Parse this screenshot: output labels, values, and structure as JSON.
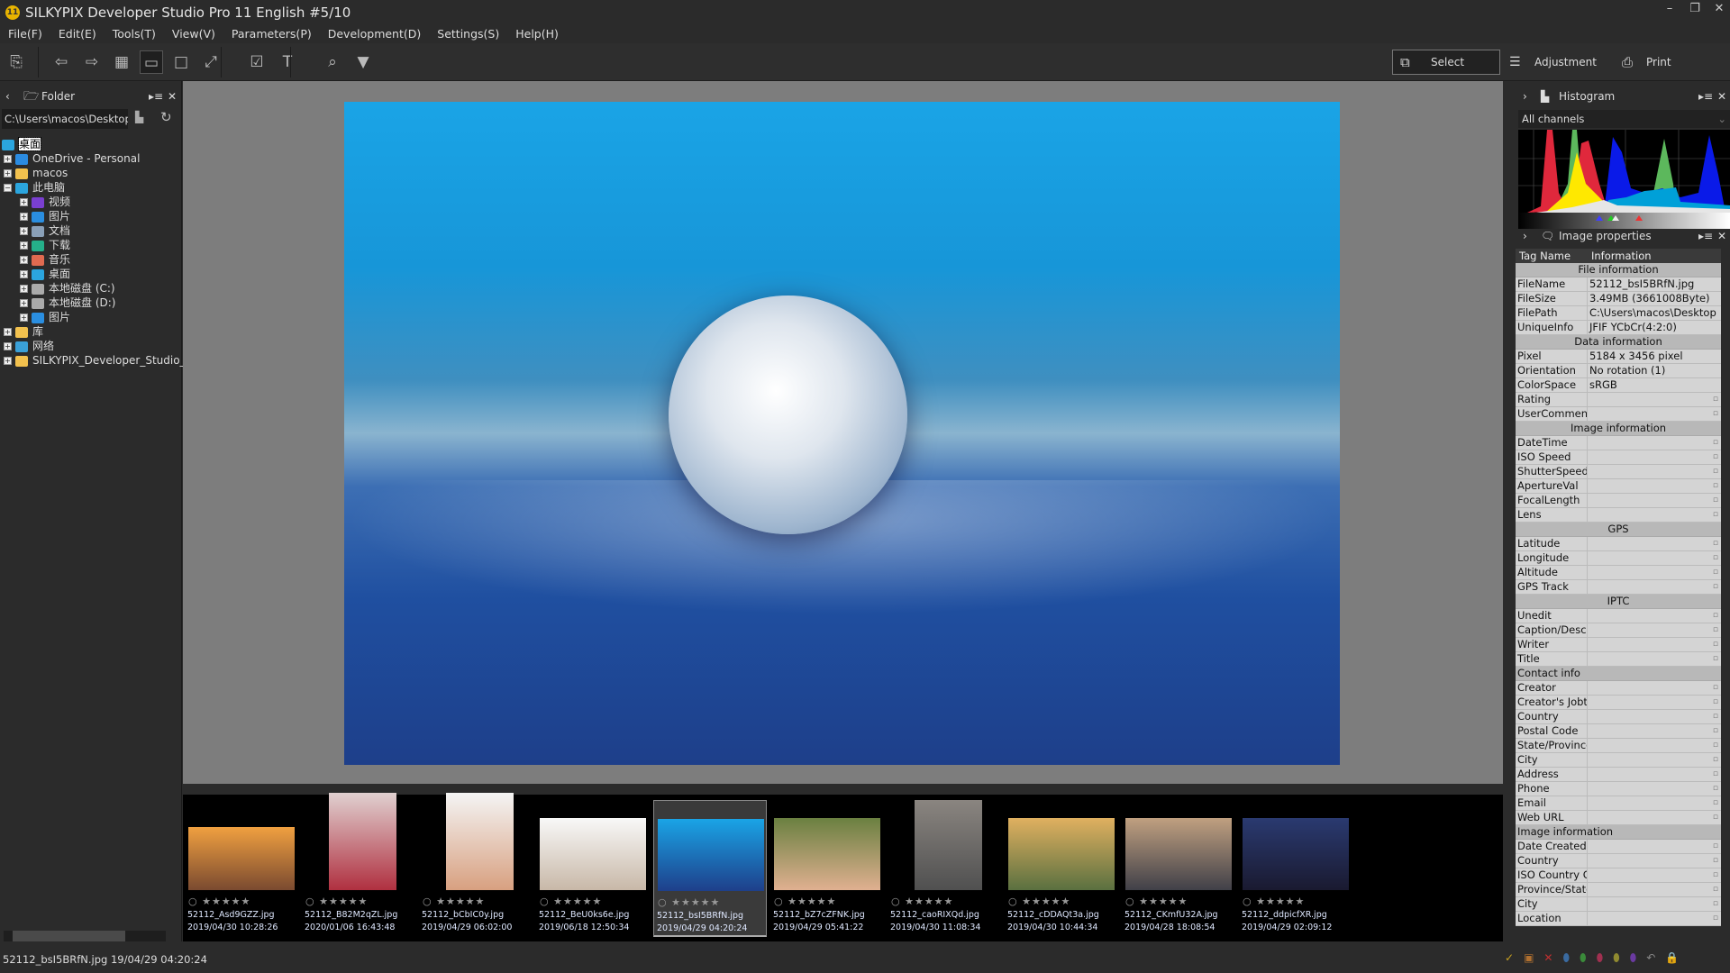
{
  "window": {
    "title": "SILKYPIX Developer Studio Pro 11 English   #5/10",
    "logo": "11"
  },
  "menu": [
    "File(F)",
    "Edit(E)",
    "Tools(T)",
    "View(V)",
    "Parameters(P)",
    "Development(D)",
    "Settings(S)",
    "Help(H)"
  ],
  "modes": {
    "select": "Select",
    "adjustment": "Adjustment",
    "print": "Print"
  },
  "folder_panel": {
    "title": "Folder",
    "path": "C:\\Users\\macos\\Desktop",
    "tree": [
      {
        "label": "桌面",
        "level": 0,
        "exp": "",
        "icon": "#2ba5de",
        "selected": true
      },
      {
        "label": "OneDrive - Personal",
        "level": 1,
        "exp": "+",
        "icon": "#2b8be0"
      },
      {
        "label": "macos",
        "level": 1,
        "exp": "+",
        "icon": "#f2c14e"
      },
      {
        "label": "此电脑",
        "level": 1,
        "exp": "−",
        "icon": "#2ba5de"
      },
      {
        "label": "视频",
        "level": 2,
        "exp": "+",
        "icon": "#7a3fd0"
      },
      {
        "label": "图片",
        "level": 2,
        "exp": "+",
        "icon": "#2a8ee0"
      },
      {
        "label": "文档",
        "level": 2,
        "exp": "+",
        "icon": "#8aa0b8"
      },
      {
        "label": "下载",
        "level": 2,
        "exp": "+",
        "icon": "#25b08a"
      },
      {
        "label": "音乐",
        "level": 2,
        "exp": "+",
        "icon": "#e06a50"
      },
      {
        "label": "桌面",
        "level": 2,
        "exp": "+",
        "icon": "#2ba5de"
      },
      {
        "label": "本地磁盘 (C:)",
        "level": 2,
        "exp": "+",
        "icon": "#aaaaaa"
      },
      {
        "label": "本地磁盘 (D:)",
        "level": 2,
        "exp": "+",
        "icon": "#aaaaaa"
      },
      {
        "label": "图片",
        "level": 2,
        "exp": "+",
        "icon": "#2a8ee0"
      },
      {
        "label": "库",
        "level": 1,
        "exp": "+",
        "icon": "#f2c14e"
      },
      {
        "label": "网络",
        "level": 1,
        "exp": "+",
        "icon": "#3aa0d8"
      },
      {
        "label": "SILKYPIX_Developer_Studio_I",
        "level": 1,
        "exp": "+",
        "icon": "#f2c14e"
      }
    ]
  },
  "histogram": {
    "title": "Histogram",
    "channel": "All channels"
  },
  "properties": {
    "title": "Image properties",
    "col_tag": "Tag Name",
    "col_info": "Information",
    "rows": [
      {
        "s": "File information"
      },
      {
        "k": "FileName",
        "v": "52112_bsI5BRfN.jpg"
      },
      {
        "k": "FileSize",
        "v": "3.49MB (3661008Byte)"
      },
      {
        "k": "FilePath",
        "v": "C:\\Users\\macos\\Desktop"
      },
      {
        "k": "UniqueInfo",
        "v": "JFIF YCbCr(4:2:0)"
      },
      {
        "s": "Data information"
      },
      {
        "k": "Pixel",
        "v": "5184 x 3456 pixel"
      },
      {
        "k": "Orientation",
        "v": "No rotation (1)"
      },
      {
        "k": "ColorSpace",
        "v": "sRGB"
      },
      {
        "k": "Rating",
        "v": ""
      },
      {
        "k": "UserComment",
        "v": ""
      },
      {
        "s": "Image information"
      },
      {
        "k": "DateTime",
        "v": ""
      },
      {
        "k": "ISO Speed",
        "v": ""
      },
      {
        "k": "ShutterSpeed",
        "v": ""
      },
      {
        "k": "ApertureVal",
        "v": ""
      },
      {
        "k": "FocalLength",
        "v": ""
      },
      {
        "k": "Lens",
        "v": ""
      },
      {
        "s": "GPS"
      },
      {
        "k": "Latitude",
        "v": ""
      },
      {
        "k": "Longitude",
        "v": ""
      },
      {
        "k": "Altitude",
        "v": ""
      },
      {
        "k": "GPS Track",
        "v": ""
      },
      {
        "s": "IPTC"
      },
      {
        "k": "Unedit",
        "v": ""
      },
      {
        "k": "Caption/Descri",
        "v": ""
      },
      {
        "k": "Writer",
        "v": ""
      },
      {
        "k": "Title",
        "v": ""
      },
      {
        "sl": "Contact info"
      },
      {
        "k": "Creator",
        "v": ""
      },
      {
        "k": "Creator's Jobtit",
        "v": ""
      },
      {
        "k": "Country",
        "v": ""
      },
      {
        "k": "Postal Code",
        "v": ""
      },
      {
        "k": "State/Province",
        "v": ""
      },
      {
        "k": "City",
        "v": ""
      },
      {
        "k": "Address",
        "v": ""
      },
      {
        "k": "Phone",
        "v": ""
      },
      {
        "k": "Email",
        "v": ""
      },
      {
        "k": "Web URL",
        "v": ""
      },
      {
        "sl": "Image information"
      },
      {
        "k": "Date Created",
        "v": ""
      },
      {
        "k": "Country",
        "v": ""
      },
      {
        "k": "ISO Country Cc",
        "v": ""
      },
      {
        "k": "Province/State",
        "v": ""
      },
      {
        "k": "City",
        "v": ""
      },
      {
        "k": "Location",
        "v": ""
      }
    ]
  },
  "thumbnails": [
    {
      "name": "52112_Asd9GZZ.jpg",
      "date": "2019/04/30 10:28:26",
      "colors": [
        "#f0a040",
        "#7a4a30"
      ],
      "h": 70
    },
    {
      "name": "52112_B82M2qZL.jpg",
      "date": "2020/01/06 16:43:48",
      "colors": [
        "#e0d0d0",
        "#b03040"
      ],
      "h": 108
    },
    {
      "name": "52112_bCbIC0y.jpg",
      "date": "2019/04/29 06:02:00",
      "colors": [
        "#f4f4f4",
        "#d8a080"
      ],
      "h": 108
    },
    {
      "name": "52112_BeU0ks6e.jpg",
      "date": "2019/06/18 12:50:34",
      "colors": [
        "#f8f8f8",
        "#c8b8a8"
      ],
      "h": 80
    },
    {
      "name": "52112_bsI5BRfN.jpg",
      "date": "2019/04/29 04:20:24",
      "colors": [
        "#1aa4e6",
        "#1e3f8a"
      ],
      "h": 80,
      "selected": true
    },
    {
      "name": "52112_bZ7cZFNK.jpg",
      "date": "2019/04/29 05:41:22",
      "colors": [
        "#6a8040",
        "#e0b090"
      ],
      "h": 80
    },
    {
      "name": "52112_caoRIXQd.jpg",
      "date": "2019/04/30 11:08:34",
      "colors": [
        "#8a8580",
        "#505050"
      ],
      "h": 100
    },
    {
      "name": "52112_cDDAQt3a.jpg",
      "date": "2019/04/30 10:44:34",
      "colors": [
        "#e0b060",
        "#5a7040"
      ],
      "h": 80
    },
    {
      "name": "52112_CKmfU32A.jpg",
      "date": "2019/04/28 18:08:54",
      "colors": [
        "#c0a080",
        "#404048"
      ],
      "h": 80
    },
    {
      "name": "52112_ddpicfXR.jpg",
      "date": "2019/04/29 02:09:12",
      "colors": [
        "#2a3a70",
        "#1a1a30"
      ],
      "h": 80
    }
  ],
  "status": {
    "text": "52112_bsI5BRfN.jpg 19/04/29 04:20:24"
  }
}
